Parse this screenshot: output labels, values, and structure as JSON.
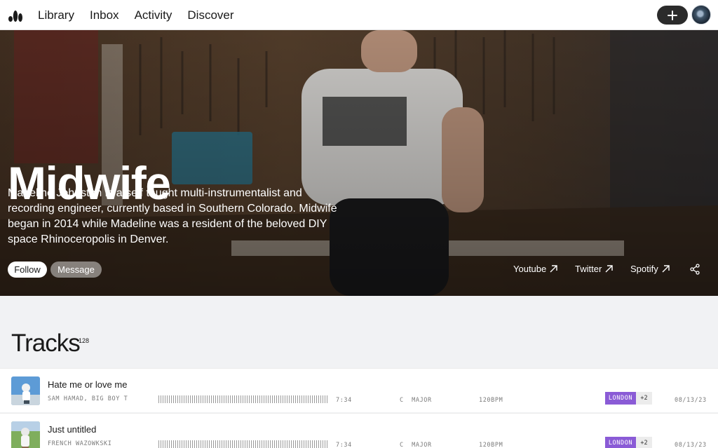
{
  "nav": {
    "items": [
      "Library",
      "Inbox",
      "Activity",
      "Discover"
    ]
  },
  "hero": {
    "title": "Midwife",
    "bio": "Madeline Johnston is a self taught multi-instrumentalist and recording engineer, currently based in Southern Colorado. Midwife began in 2014 while Madeline was a resident of the beloved DIY space Rhinoceropolis in Denver.",
    "follow_label": "Follow",
    "message_label": "Message",
    "links": [
      {
        "label": "Youtube",
        "icon": "arrow-up-right-icon"
      },
      {
        "label": "Twitter",
        "icon": "arrow-up-right-icon"
      },
      {
        "label": "Spotify",
        "icon": "arrow-up-right-icon"
      }
    ],
    "share_icon": "share-icon"
  },
  "tracks": {
    "title": "Tracks",
    "count": "128",
    "rows": [
      {
        "title": "Hate me or love me",
        "artists": "SAM HAMAD, BIG BOY T",
        "duration": "7:34",
        "key": "C  MAJOR",
        "bpm": "120BPM",
        "location": "LONDON",
        "more": "+2",
        "date": "08/13/23"
      },
      {
        "title": "Just untitled",
        "artists": "FRENCH WAZOWKSKI",
        "duration": "7:34",
        "key": "C  MAJOR",
        "bpm": "120BPM",
        "location": "LONDON",
        "more": "+2",
        "date": "08/13/23"
      }
    ]
  },
  "colors": {
    "accent": "#8a5bd6",
    "nav_button": "#2b2b2b",
    "page_bg": "#f1f2f4"
  }
}
